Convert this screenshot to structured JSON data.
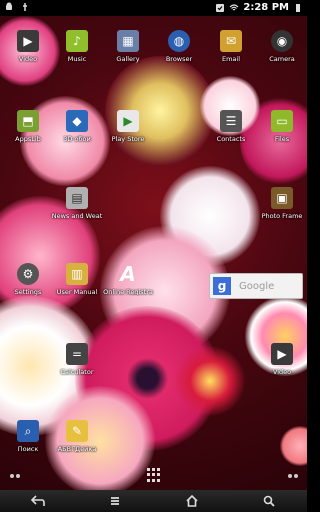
{
  "statusbar": {
    "time": "2:28 PM"
  },
  "apps": [
    {
      "id": "video",
      "label": "Video",
      "icon": "video-icon",
      "color": "#3a3a3a"
    },
    {
      "id": "music",
      "label": "Music",
      "icon": "music-icon",
      "color": "#8fbf2a"
    },
    {
      "id": "gallery",
      "label": "Gallery",
      "icon": "gallery-icon",
      "color": "#6a7fa8"
    },
    {
      "id": "browser",
      "label": "Browser",
      "icon": "globe-icon",
      "color": "#2a5fb0"
    },
    {
      "id": "email",
      "label": "Email",
      "icon": "email-icon",
      "color": "#d0a030"
    },
    {
      "id": "camera",
      "label": "Camera",
      "icon": "camera-icon",
      "color": "#333333"
    },
    {
      "id": "appslib",
      "label": "AppsLib",
      "icon": "appslib-icon",
      "color": "#7aa032"
    },
    {
      "id": "3d",
      "label": "3D обои",
      "icon": "cube-icon",
      "color": "#2a6ab8"
    },
    {
      "id": "playstore",
      "label": "Play Store",
      "icon": "play-store-icon",
      "color": "#e8e8e8"
    },
    {
      "id": "contacts",
      "label": "Contacts",
      "icon": "contacts-icon",
      "color": "#555555"
    },
    {
      "id": "files",
      "label": "Files",
      "icon": "folder-icon",
      "color": "#8fb82a"
    },
    {
      "id": "news",
      "label": "News and Weat",
      "icon": "news-icon",
      "color": "#b0b0b0"
    },
    {
      "id": "photoframe",
      "label": "Photo Frame",
      "icon": "photo-frame-icon",
      "color": "#7a5a2a"
    },
    {
      "id": "settings",
      "label": "Settings",
      "icon": "settings-icon",
      "color": "#555555"
    },
    {
      "id": "usermanual",
      "label": "User Manual",
      "icon": "manual-icon",
      "color": "#d8b040"
    },
    {
      "id": "onlinereg",
      "label": "Online Registra",
      "icon": "registration-icon",
      "color": "transparent"
    },
    {
      "id": "video2",
      "label": "Video",
      "icon": "video-icon",
      "color": "#3a3a3a"
    },
    {
      "id": "calculator",
      "label": "Calculator",
      "icon": "calculator-icon",
      "color": "#444444"
    },
    {
      "id": "search",
      "label": "Поиск",
      "icon": "search-icon",
      "color": "#2a5fb0"
    },
    {
      "id": "abc",
      "label": "АБВГДейка",
      "icon": "abc-icon",
      "color": "#e8c040"
    }
  ],
  "google_widget": {
    "placeholder": "Google",
    "logo": "g"
  },
  "navbar": {
    "buttons": [
      "back-icon",
      "menu-icon",
      "home-icon",
      "search-icon"
    ]
  }
}
